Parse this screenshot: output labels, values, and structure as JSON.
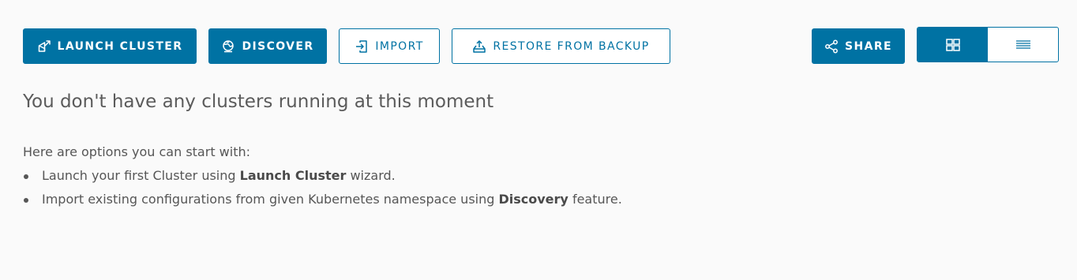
{
  "toolbar": {
    "launch_label": "LAUNCH CLUSTER",
    "discover_label": "DISCOVER",
    "import_label": "IMPORT",
    "restore_label": "RESTORE FROM BACKUP",
    "share_label": "SHARE"
  },
  "view_toggle": {
    "selected": "grid-view",
    "options": [
      "grid-view",
      "list-view"
    ]
  },
  "empty_state": {
    "heading": "You don't have any clusters running at this moment",
    "intro": "Here are options you can start with:",
    "options": [
      {
        "before": "Launch your first Cluster using ",
        "bold": "Launch Cluster",
        "after": " wizard."
      },
      {
        "before": "Import existing configurations from given Kubernetes namespace using ",
        "bold": "Discovery",
        "after": " feature."
      }
    ]
  },
  "icons": {
    "launch": "launch-icon",
    "discover": "globe-icon",
    "import": "import-icon",
    "restore": "upload-icon",
    "share": "share-icon",
    "grid": "grid-icon",
    "list": "list-icon"
  },
  "colors": {
    "accent": "#0072a3",
    "background": "#fafafa",
    "text": "#565656"
  }
}
